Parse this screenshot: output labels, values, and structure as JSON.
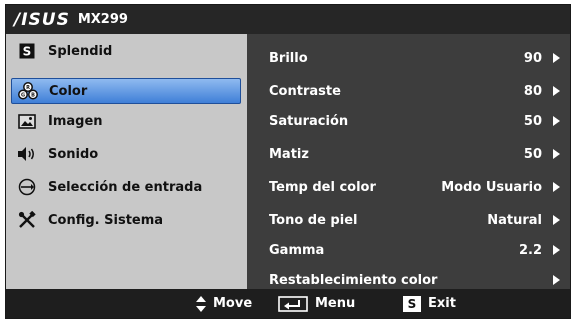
{
  "header": {
    "brand": "/ISUS",
    "model": "MX299"
  },
  "sidebar": {
    "items": [
      {
        "label": "Splendid",
        "icon": "splendid-s-icon"
      },
      {
        "label": "Color",
        "icon": "color-palette-icon",
        "selected": true
      },
      {
        "label": "Imagen",
        "icon": "image-icon"
      },
      {
        "label": "Sonido",
        "icon": "speaker-icon"
      },
      {
        "label": "Selección de entrada",
        "icon": "input-select-icon"
      },
      {
        "label": "Config. Sistema",
        "icon": "tools-icon"
      }
    ]
  },
  "content": {
    "rows": [
      {
        "label": "Brillo",
        "value": "90"
      },
      {
        "label": "Contraste",
        "value": "80"
      },
      {
        "label": "Saturación",
        "value": "50"
      },
      {
        "label": "Matiz",
        "value": "50"
      },
      {
        "label": "Temp del color",
        "value": "Modo Usuario"
      },
      {
        "label": "Tono de piel",
        "value": "Natural"
      },
      {
        "label": "Gamma",
        "value": "2.2"
      },
      {
        "label": "Restablecimiento color",
        "value": ""
      }
    ]
  },
  "footer": {
    "move": "Move",
    "menu": "Menu",
    "exit": "Exit",
    "exit_key": "S"
  },
  "colors": {
    "selection": "#3f7fd8",
    "sidebar_bg": "#c8c8c8",
    "content_bg": "#3d3d3d"
  }
}
